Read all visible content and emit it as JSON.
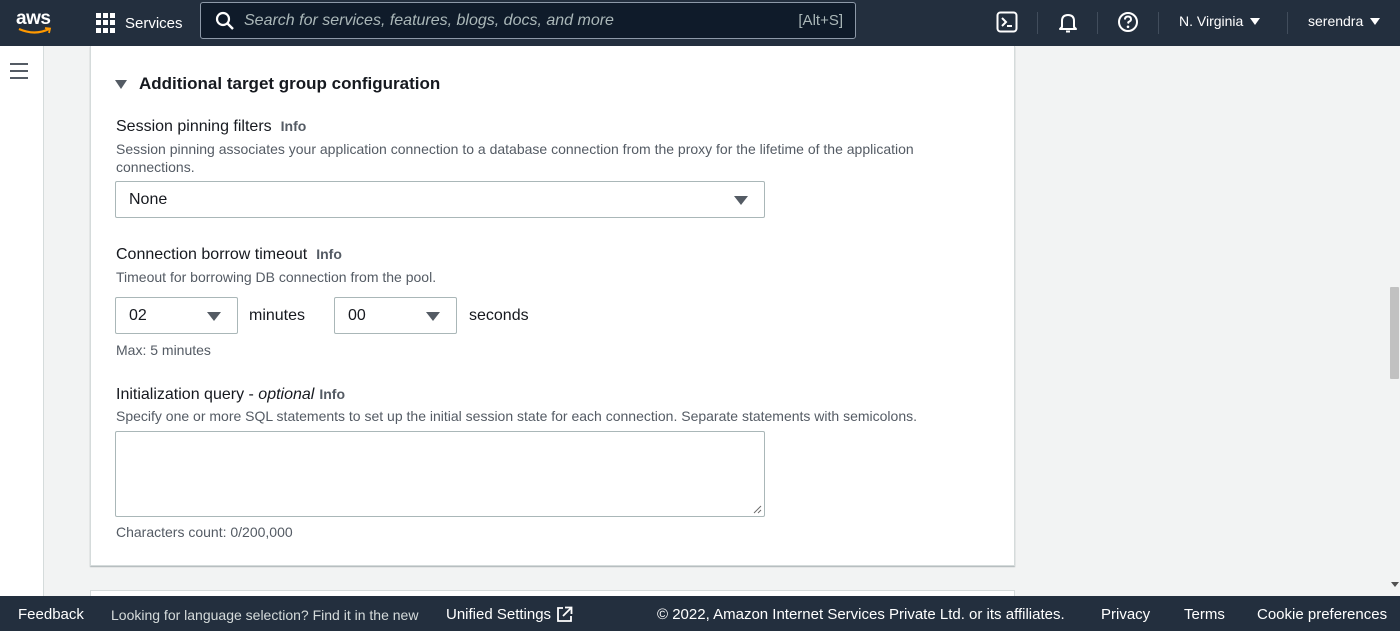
{
  "topnav": {
    "logo_text": "aws",
    "services_label": "Services",
    "search_placeholder": "Search for services, features, blogs, docs, and more",
    "search_shortcut": "[Alt+S]",
    "region_label": "N. Virginia",
    "user_label": "serendra",
    "icons": [
      "cloudshell-icon",
      "bell-icon",
      "help-icon"
    ]
  },
  "section": {
    "title": "Additional target group configuration",
    "session_pinning": {
      "label": "Session pinning filters",
      "info": "Info",
      "description_line1": "Session pinning associates your application connection to a database connection from the proxy for the lifetime of the application",
      "description_line2": "connections.",
      "selected": "None"
    },
    "borrow_timeout": {
      "label": "Connection borrow timeout",
      "info": "Info",
      "description": "Timeout for borrowing DB connection from the pool.",
      "minutes_value": "02",
      "minutes_unit": "minutes",
      "seconds_value": "00",
      "seconds_unit": "seconds",
      "constraint": "Max: 5 minutes"
    },
    "init_query": {
      "label": "Initialization query - ",
      "optional": "optional",
      "info": "Info",
      "description": "Specify one or more SQL statements to set up the initial session state for each connection. Separate statements with semicolons.",
      "value": "",
      "char_count": "Characters count: 0/200,000"
    }
  },
  "footer": {
    "feedback": "Feedback",
    "language_prompt": "Looking for language selection? Find it in the new",
    "unified_settings": "Unified Settings",
    "copyright": "© 2022, Amazon Internet Services Private Ltd. or its affiliates.",
    "privacy": "Privacy",
    "terms": "Terms",
    "cookie_preferences": "Cookie preferences"
  }
}
